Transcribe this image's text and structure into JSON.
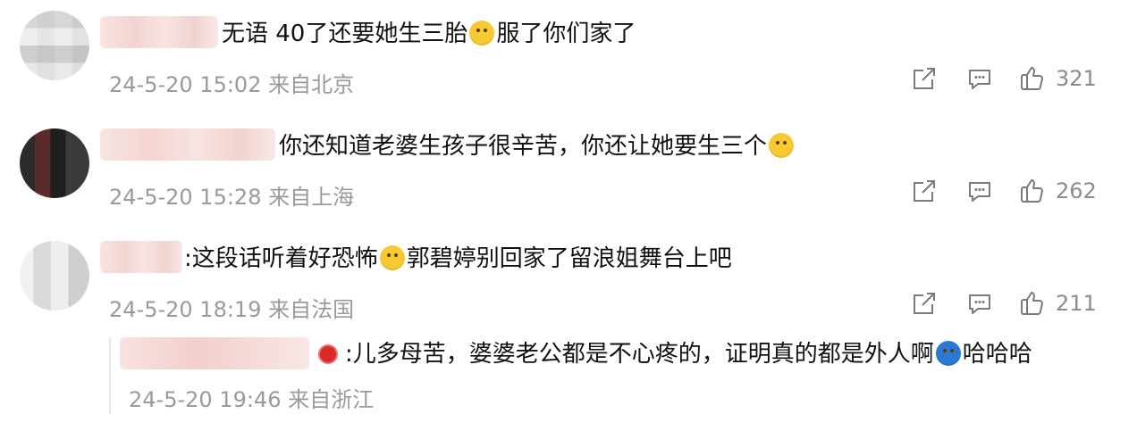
{
  "comments": [
    {
      "text_before": "无语 40了还要她生三胎",
      "emoji": "smile-emoji",
      "text_after": "服了你们家了",
      "meta": "24-5-20 15:02 来自北京",
      "likes": "321"
    },
    {
      "text_before": "你还知道老婆生孩子很辛苦，你还让她要生三个",
      "emoji": "question-emoji",
      "text_after": "",
      "meta": "24-5-20 15:28 来自上海",
      "likes": "262"
    },
    {
      "text_before": ":这段话听着好恐怖",
      "emoji": "smile-emoji",
      "text_after": "郭碧婷别回家了留浪姐舞台上吧",
      "meta": "24-5-20 18:19 来自法国",
      "likes": "211"
    }
  ],
  "reply": {
    "text_before": ":儿多母苦，婆婆老公都是不心疼的，证明真的都是外人啊",
    "emoji": "crying-emoji",
    "text_after": "哈哈哈",
    "meta": "24-5-20 19:46 来自浙江"
  }
}
